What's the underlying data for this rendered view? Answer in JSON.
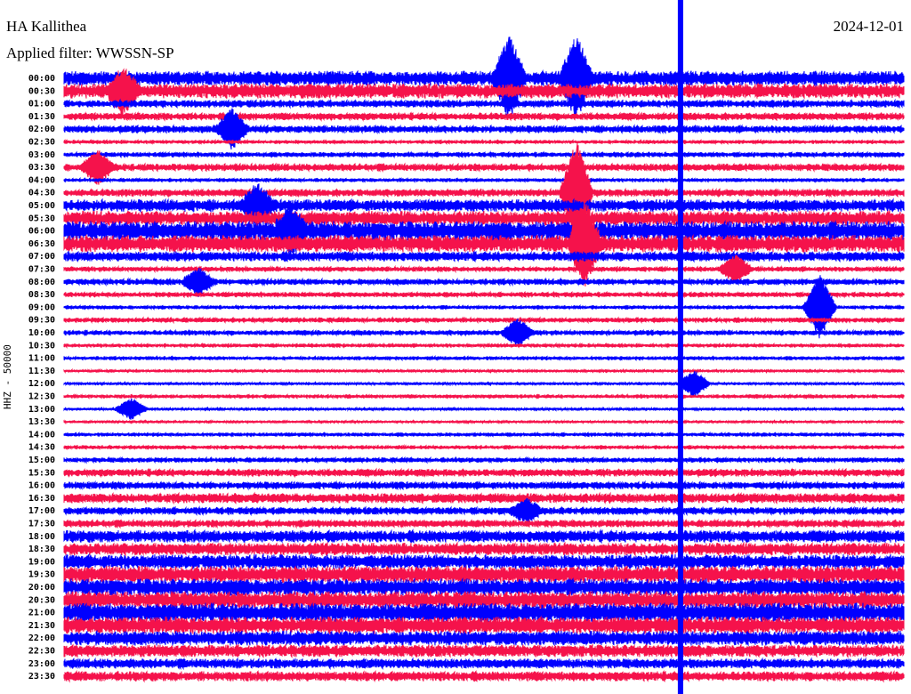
{
  "header": {
    "station": "HA Kallithea",
    "date": "2024-12-01",
    "filter": "Applied filter: WWSSN-SP"
  },
  "chart_data": {
    "type": "line",
    "title": "HA Kallithea",
    "ylabel": "HHZ - 50000",
    "colors": [
      "#0000ff",
      "#f5124b"
    ],
    "rows": [
      "00:00",
      "00:30",
      "01:00",
      "01:30",
      "02:00",
      "02:30",
      "03:00",
      "03:30",
      "04:00",
      "04:30",
      "05:00",
      "05:30",
      "06:00",
      "06:30",
      "07:00",
      "07:30",
      "08:00",
      "08:30",
      "09:00",
      "09:30",
      "10:00",
      "10:30",
      "11:00",
      "11:30",
      "12:00",
      "12:30",
      "13:00",
      "13:30",
      "14:00",
      "14:30",
      "15:00",
      "15:30",
      "16:00",
      "16:30",
      "17:00",
      "17:30",
      "18:00",
      "18:30",
      "19:00",
      "19:30",
      "20:00",
      "20:30",
      "21:00",
      "21:30",
      "22:00",
      "22:30",
      "23:00",
      "23:30"
    ],
    "noise_level": [
      0.6,
      0.6,
      0.3,
      0.3,
      0.3,
      0.15,
      0.2,
      0.3,
      0.15,
      0.3,
      0.5,
      0.6,
      0.8,
      0.7,
      0.4,
      0.2,
      0.25,
      0.2,
      0.15,
      0.2,
      0.2,
      0.15,
      0.15,
      0.1,
      0.1,
      0.15,
      0.1,
      0.08,
      0.15,
      0.15,
      0.2,
      0.3,
      0.3,
      0.4,
      0.3,
      0.3,
      0.5,
      0.5,
      0.6,
      0.7,
      0.7,
      0.7,
      0.8,
      0.7,
      0.6,
      0.5,
      0.4,
      0.4
    ],
    "events": [
      [
        0,
        0.53,
        3
      ],
      [
        0,
        0.61,
        3
      ],
      [
        1,
        0.07,
        1.5
      ],
      [
        4,
        0.2,
        1.5
      ],
      [
        7,
        0.04,
        1.2
      ],
      [
        9,
        0.61,
        4
      ],
      [
        10,
        0.23,
        1.5
      ],
      [
        12,
        0.27,
        1.5
      ],
      [
        13,
        0.62,
        3
      ],
      [
        15,
        0.8,
        1
      ],
      [
        16,
        0.16,
        1
      ],
      [
        18,
        0.9,
        2.5
      ],
      [
        20,
        0.54,
        1
      ],
      [
        24,
        0.75,
        1
      ],
      [
        26,
        0.08,
        0.8
      ],
      [
        34,
        0.55,
        0.8
      ]
    ],
    "saturated_minute_fraction": 0.734,
    "x_minutes_per_row": 30
  }
}
